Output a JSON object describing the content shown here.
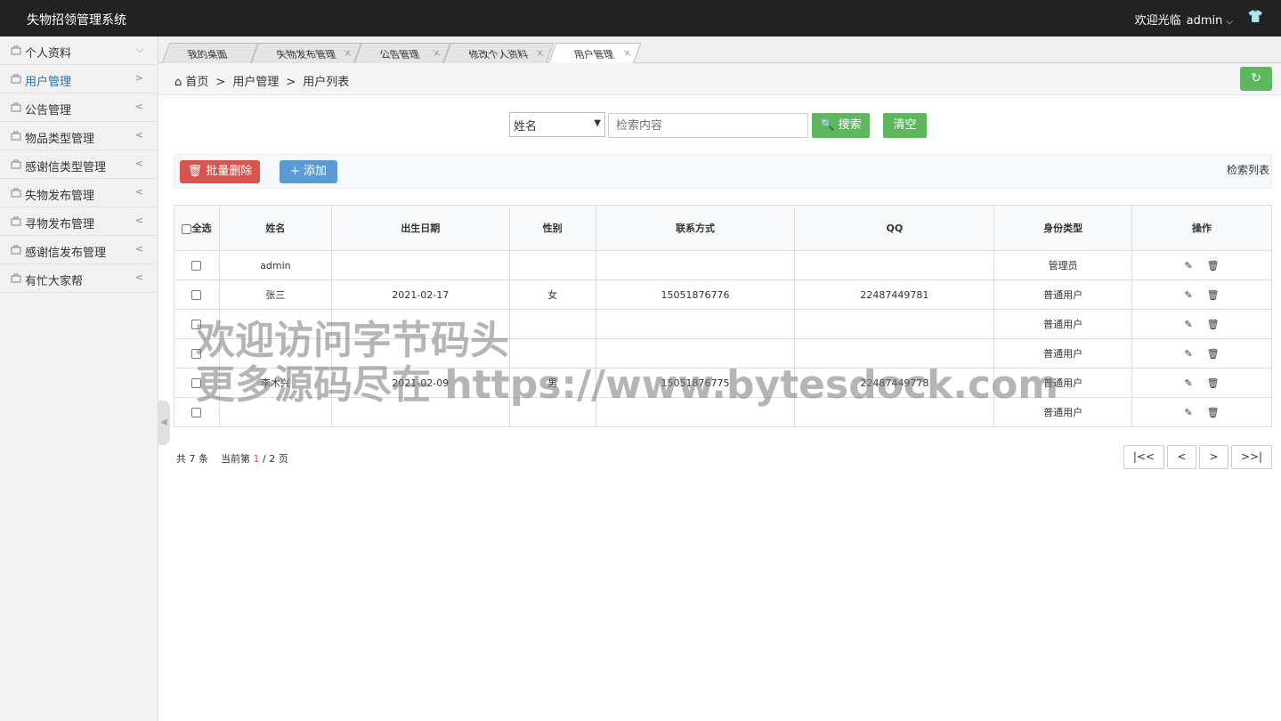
{
  "header": {
    "title": "失物招领管理系统",
    "welcome": "欢迎光临",
    "user": "admin"
  },
  "sidebar": {
    "items": [
      {
        "label": "个人资料",
        "arrow": "⌵"
      },
      {
        "label": "用户管理",
        "arrow": ">"
      },
      {
        "label": "公告管理",
        "arrow": "<"
      },
      {
        "label": "物品类型管理",
        "arrow": "<"
      },
      {
        "label": "感谢信类型管理",
        "arrow": "<"
      },
      {
        "label": "失物发布管理",
        "arrow": "<"
      },
      {
        "label": "寻物发布管理",
        "arrow": "<"
      },
      {
        "label": "感谢信发布管理",
        "arrow": "<"
      },
      {
        "label": "有忙大家帮",
        "arrow": "<"
      }
    ]
  },
  "tabs": [
    {
      "label": "我的桌面",
      "close": ""
    },
    {
      "label": "失物发布管理",
      "close": "×"
    },
    {
      "label": "公告管理",
      "close": "×"
    },
    {
      "label": "修改个人资料",
      "close": "×"
    },
    {
      "label": "用户管理",
      "close": "×"
    }
  ],
  "breadcrumb": {
    "home": "首页",
    "sep": ">",
    "level1": "用户管理",
    "level2": "用户列表"
  },
  "search": {
    "field_select": "姓名",
    "placeholder": "检索内容",
    "search_label": "搜索",
    "clear_label": "清空"
  },
  "toolbar": {
    "batch_delete": "批量删除",
    "add": "添加",
    "search_list": "检索列表"
  },
  "table": {
    "select_all": "全选",
    "columns": [
      "姓名",
      "出生日期",
      "性别",
      "联系方式",
      "QQ",
      "身份类型",
      "操作"
    ],
    "rows": [
      {
        "name": "admin",
        "birth": "",
        "gender": "",
        "phone": "",
        "qq": "",
        "role": "管理员"
      },
      {
        "name": "张三",
        "birth": "2021-02-17",
        "gender": "女",
        "phone": "15051876776",
        "qq": "22487449781",
        "role": "普通用户"
      },
      {
        "name": "",
        "birth": "",
        "gender": "",
        "phone": "",
        "qq": "",
        "role": "普通用户"
      },
      {
        "name": "",
        "birth": "",
        "gender": "",
        "phone": "",
        "qq": "",
        "role": "普通用户"
      },
      {
        "name": "李木兴",
        "birth": "2021-02-09",
        "gender": "男",
        "phone": "15051876775",
        "qq": "22487449778",
        "role": "普通用户"
      },
      {
        "name": "",
        "birth": "",
        "gender": "",
        "phone": "",
        "qq": "",
        "role": "普通用户"
      }
    ]
  },
  "pager": {
    "total_prefix": "共",
    "total": "7",
    "total_suffix": "条",
    "current_prefix": "当前第",
    "current": "1",
    "slash": "/",
    "pages": "2",
    "pages_suffix": "页",
    "first": "|<<",
    "prev": "<",
    "next": ">",
    "last": ">>|"
  },
  "watermark": {
    "line1": "欢迎访问字节码头",
    "line2": "更多源码尽在 https://www.bytesdock.com"
  },
  "colors": {
    "topbar": "#222222",
    "green": "#5cb85c",
    "red": "#d9534f",
    "blue": "#5b9bd5",
    "active_link": "#2a6fb0"
  }
}
